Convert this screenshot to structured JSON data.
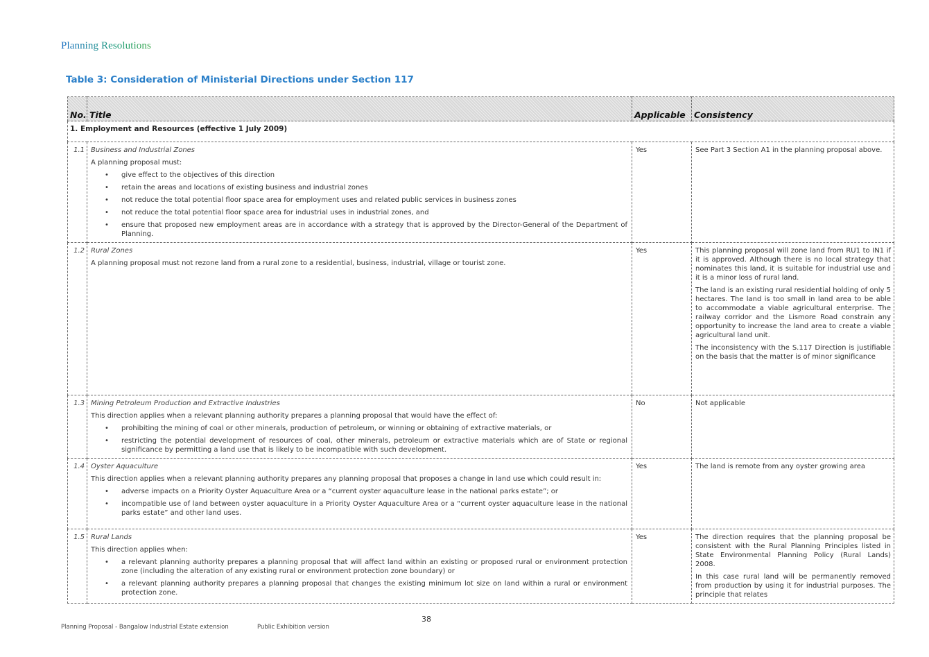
{
  "header": {
    "brand": "Planning Resolutions"
  },
  "table_title": "Table 3: Consideration of Ministerial Directions under Section 117",
  "columns": {
    "no": "No.",
    "title": "Title",
    "applicable": "Applicable",
    "consistency": "Consistency"
  },
  "section": "1. Employment and Resources (effective 1 July 2009)",
  "rows": [
    {
      "no": "1.1",
      "title": "Business and Industrial Zones",
      "intro": "A planning proposal must:",
      "bullets": [
        "give effect to the objectives of this direction",
        "retain the areas and locations of existing business and industrial zones",
        "not reduce the total potential floor space area for employment uses and related public services in business zones",
        "not reduce the total potential floor space area for industrial uses in industrial zones, and",
        "ensure that proposed new employment areas are in accordance with a strategy that is approved by the Director-General of the Department of Planning."
      ],
      "applicable": "Yes",
      "consistency": [
        "See Part 3 Section A1 in the planning proposal above."
      ]
    },
    {
      "no": "1.2",
      "title": "Rural Zones",
      "intro": "A planning proposal must not rezone land from a rural zone to a residential, business, industrial, village or tourist zone.",
      "applicable": "Yes",
      "consistency": [
        "This planning proposal will zone land from RU1 to IN1 if it is approved. Although there is no local strategy that nominates this land, it is suitable for industrial use and it is a minor loss of rural land.",
        "The land is an existing rural residential holding of only 5 hectares.  The land is too small in land area to be able to accommodate a viable agricultural enterprise. The railway corridor and the Lismore Road constrain any opportunity to increase the land area to create a viable agricultural land unit.",
        "The inconsistency with the S.117 Direction is justifiable on the basis that the matter is of minor significance"
      ]
    },
    {
      "no": "1.3",
      "title": "Mining Petroleum Production and Extractive Industries",
      "intro": "This direction applies when a relevant planning authority prepares a planning proposal that would have the effect of:",
      "bullets": [
        "prohibiting the mining of coal or other minerals, production of petroleum, or winning or obtaining of extractive materials, or",
        "restricting the potential development of resources of coal, other minerals, petroleum or extractive materials which are of State or regional significance by permitting a land use that is likely to be incompatible with such development."
      ],
      "applicable": "No",
      "consistency": [
        "Not applicable"
      ]
    },
    {
      "no": "1.4",
      "title": "Oyster Aquaculture",
      "intro": "This direction applies when a relevant planning authority prepares any planning proposal that proposes a change in land use which could result in:",
      "bullets": [
        "adverse impacts on a Priority Oyster Aquaculture Area or a “current oyster aquaculture lease in the national parks estate”; or",
        "incompatible use of land between oyster aquaculture in a Priority Oyster Aquaculture Area or a “current oyster aquaculture lease in the national parks estate” and other land uses."
      ],
      "applicable": "Yes",
      "consistency": [
        "The land is remote from any oyster growing area"
      ]
    },
    {
      "no": "1.5",
      "title": "Rural Lands",
      "intro": "This direction applies when:",
      "bullets": [
        "a relevant planning authority prepares a planning proposal that will affect land within an existing or proposed rural or environment protection zone (including the alteration of any existing rural or environment protection zone boundary) or",
        "a relevant planning authority prepares a planning proposal that changes the existing minimum lot size on land within a rural or environment protection zone."
      ],
      "applicable": "Yes",
      "consistency": [
        "The direction requires that the planning proposal be consistent with the Rural Planning Principles listed in State Environmental Planning Policy (Rural Lands) 2008.",
        "In this case rural land will be permanently removed from production by using it for industrial purposes. The principle that relates"
      ]
    }
  ],
  "footer": {
    "page_number": "38",
    "doc_title": "Planning Proposal - Bangalow Industrial Estate extension",
    "version": "Public Exhibition version"
  }
}
